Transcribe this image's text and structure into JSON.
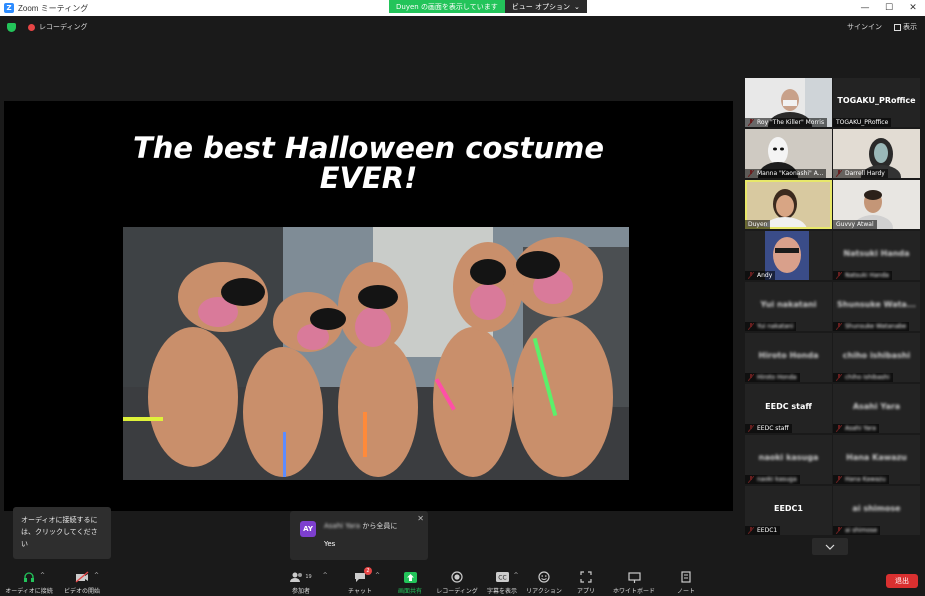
{
  "window": {
    "title": "Zoom ミーティング",
    "app_icon": "zoom-icon"
  },
  "share_banner": {
    "status": "Duyen の画面を表示しています",
    "view_options": "ビュー オプション"
  },
  "topbar": {
    "recording_label": "レコーディング",
    "sign_in": "サインイン",
    "view": "表示"
  },
  "slide": {
    "title_line1": "The best Halloween costume",
    "title_line2": "EVER!"
  },
  "gallery": {
    "tiles": [
      {
        "name": "Roy \"The Killer\" Morris",
        "type": "video",
        "muted": true
      },
      {
        "name": "TOGAKU_PRoffice",
        "big_name": "TOGAKU_PRoffice",
        "type": "name",
        "muted": false
      },
      {
        "name": "Manna \"Kaonashi\" A...",
        "type": "video",
        "muted": true
      },
      {
        "name": "Darrell Hardy",
        "type": "video",
        "muted": true
      },
      {
        "name": "Duyen",
        "type": "video",
        "muted": false,
        "active": true
      },
      {
        "name": "Guvvy Atwal",
        "type": "video",
        "muted": false
      },
      {
        "name": "Andy",
        "type": "video",
        "muted": true
      },
      {
        "name": "Natsuki Handa",
        "big_name": "Natsuki Handa",
        "type": "name",
        "muted": true,
        "blurred": true
      },
      {
        "name": "Yui nakatani",
        "big_name": "Yui nakatani",
        "type": "name",
        "muted": true,
        "blurred": true
      },
      {
        "name": "Shunsuke Watanabe",
        "big_name": "Shunsuke Wata...",
        "type": "name",
        "muted": true,
        "blurred": true
      },
      {
        "name": "Hiroto Honda",
        "big_name": "Hiroto Honda",
        "type": "name",
        "muted": true,
        "blurred": true
      },
      {
        "name": "chiho ishibashi",
        "big_name": "chiho ishibashi",
        "type": "name",
        "muted": true,
        "blurred": true
      },
      {
        "name": "EEDC staff",
        "big_name": "EEDC staff",
        "type": "name",
        "muted": true
      },
      {
        "name": "Asahi Yara",
        "big_name": "Asahi Yara",
        "type": "name",
        "muted": true,
        "blurred": true
      },
      {
        "name": "naoki kasuga",
        "big_name": "naoki kasuga",
        "type": "name",
        "muted": true,
        "blurred": true
      },
      {
        "name": "Hana Kawazu",
        "big_name": "Hana Kawazu",
        "type": "name",
        "muted": true,
        "blurred": true
      },
      {
        "name": "EEDC1",
        "big_name": "EEDC1",
        "type": "name",
        "muted": true
      },
      {
        "name": "ai shimose",
        "big_name": "ai shimose",
        "type": "name",
        "muted": true,
        "blurred": true
      }
    ]
  },
  "audio_tooltip": {
    "text": "オーディオに接続するには、クリックしてください"
  },
  "chat_popup": {
    "avatar_initials": "AY",
    "sender_name": "Asahi Yara",
    "sender_suffix": " から全員に",
    "message": "Yes"
  },
  "toolbar": {
    "audio": "オーディオに接続",
    "video": "ビデオの開始",
    "participants": "参加者",
    "participants_count": "19",
    "chat": "チャット",
    "chat_badge": "2",
    "share": "画面共有",
    "record": "レコーディング",
    "captions": "字幕を表示",
    "reactions": "リアクション",
    "apps": "アプリ",
    "whiteboard": "ホワイトボード",
    "notes": "ノート",
    "leave": "退出"
  },
  "colors": {
    "share_green": "#23c45a",
    "leave_red": "#d93030",
    "active_speaker": "#e8e86a",
    "avatar_purple": "#7d3fcf"
  }
}
